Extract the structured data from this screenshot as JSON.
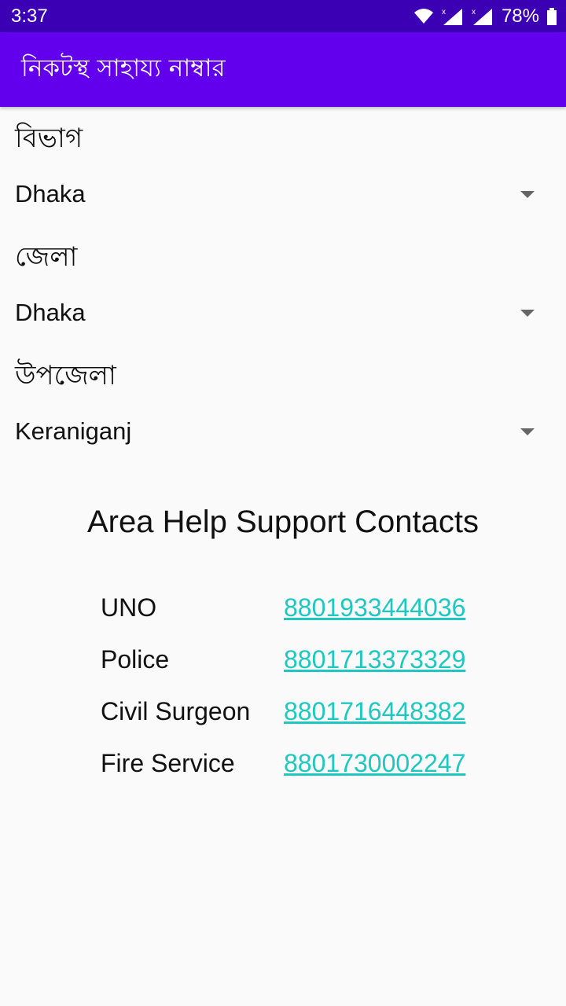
{
  "status_bar": {
    "time": "3:37",
    "battery_percent": "78%",
    "icons": [
      "wifi-icon",
      "signal-icon",
      "signal-icon",
      "battery-icon"
    ]
  },
  "app_bar": {
    "title": "নিকটস্থ সাহায্য নাম্বার"
  },
  "form": {
    "division": {
      "label": "বিভাগ",
      "value": "Dhaka"
    },
    "district": {
      "label": "জেলা",
      "value": "Dhaka"
    },
    "upazila": {
      "label": "উপজেলা",
      "value": "Keraniganj"
    }
  },
  "contacts": {
    "title": "Area Help Support Contacts",
    "items": [
      {
        "name": "UNO",
        "phone": "8801933444036"
      },
      {
        "name": "Police",
        "phone": "8801713373329"
      },
      {
        "name": "Civil Surgeon",
        "phone": "8801716448382"
      },
      {
        "name": "Fire Service",
        "phone": "8801730002247"
      }
    ]
  },
  "colors": {
    "status_bar": "#3b00b3",
    "app_bar": "#6200ee",
    "link": "#1ec8c0",
    "background": "#fafafa"
  }
}
